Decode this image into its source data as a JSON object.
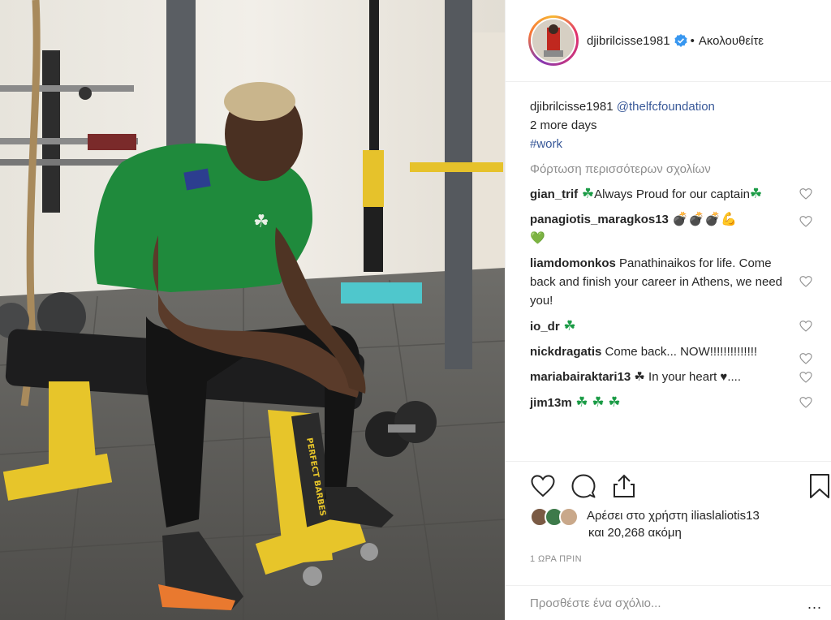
{
  "post": {
    "username": "djibrilcisse1981",
    "follow_label": "Ακολουθείτε",
    "separator": "•",
    "caption": {
      "username": "djibrilcisse1981",
      "mention": "@thelfcfoundation",
      "line2": "2 more days",
      "hashtag": "#work"
    },
    "load_more": "Φόρτωση περισσότερων σχολίων",
    "comments": [
      {
        "user": "gian_trif",
        "text_a": " ☘",
        "text_b": "Always Proud for our captain",
        "text_c": "☘"
      },
      {
        "user": "panagiotis_maragkos13",
        "text": " 💣💣💣💪",
        "text_line2": "💚"
      },
      {
        "user": "liamdomonkos",
        "text": " Panathinaikos for life. Come back and finish your career in Athens, we need you!"
      },
      {
        "user": "io_dr",
        "text": " ☘"
      },
      {
        "user": "nickdragatis",
        "text": " Come back... NOW!!!!!!!!!!!!!!"
      },
      {
        "user": "mariabairaktari13",
        "text": " ☘ In your heart ♥...."
      },
      {
        "user": "jim13m",
        "text": " ☘ ☘ ☘"
      }
    ],
    "likes_prefix": "Αρέσει στο χρήστη ",
    "likes_user": "iliaslaliotis13",
    "likes_suffix": "και 20,268 ακόμη",
    "time": "1 ΩΡΑ ΠΡΙΝ",
    "add_comment_placeholder": "Προσθέστε ένα σχόλιο...",
    "more_options": "..."
  },
  "photo": {
    "bench_text": "PERFECT BARBES"
  },
  "colors": {
    "link": "#385898",
    "muted": "#8e8e8e",
    "verified": "#3897f0",
    "shamrock": "#1a9b45"
  },
  "icons": [
    "heart-icon",
    "comment-icon",
    "share-icon",
    "bookmark-icon",
    "verified-icon",
    "more-options-icon"
  ]
}
